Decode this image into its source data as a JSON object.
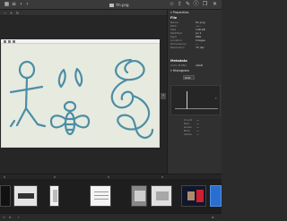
{
  "window": {
    "title": "fm.png"
  },
  "toolbar": {
    "left_icons": [
      "grid-icon",
      "menu-icon",
      "back-icon",
      "forward-icon"
    ],
    "right_icons": [
      "star-icon",
      "share-icon",
      "edit-icon",
      "info-icon",
      "copy-icon",
      "close-icon"
    ]
  },
  "panel": {
    "properties_header": "Properties",
    "file_section": "File",
    "file_rows": [
      {
        "key": "Name",
        "value": "fm.png"
      },
      {
        "key": "Path",
        "value": "~/…"
      },
      {
        "key": "Size",
        "value": "148 KB"
      },
      {
        "key": "Modified",
        "value": "Jul 1"
      },
      {
        "key": "Type",
        "value": "PNG"
      },
      {
        "key": "Location",
        "value": "Images"
      },
      {
        "key": "Dimensions",
        "value": "—"
      },
      {
        "key": "Resolution",
        "value": "72 dpi"
      }
    ],
    "metadata_section": "Metadata",
    "metadata_row": {
      "key": "Color Profile",
      "value": "sRGB"
    },
    "histogram_header": "Histogram",
    "histogram_select": "RGB",
    "stats": [
      {
        "key": "Count",
        "value": "—"
      },
      {
        "key": "Red",
        "value": "—"
      },
      {
        "key": "Green",
        "value": "—"
      },
      {
        "key": "Blue",
        "value": "—"
      },
      {
        "key": "Alpha",
        "value": "—"
      }
    ]
  },
  "colors": {
    "accent": "#4e8fe0",
    "ink": "#2f7f9a",
    "paper": "#e7eadf"
  }
}
